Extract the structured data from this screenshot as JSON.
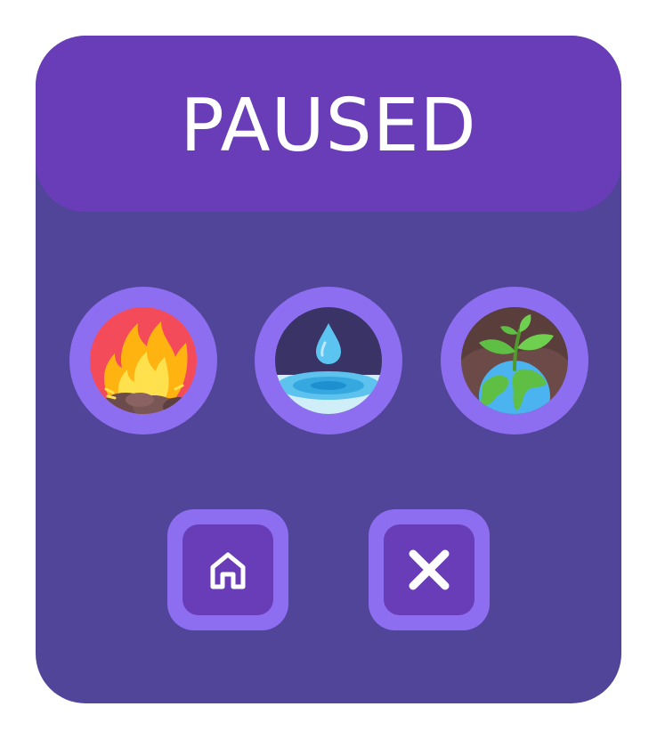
{
  "pause_menu": {
    "title": "PAUSED"
  },
  "elements": [
    {
      "name": "fire",
      "icon": "fire-icon"
    },
    {
      "name": "water",
      "icon": "water-drop-icon"
    },
    {
      "name": "earth",
      "icon": "earth-plant-icon"
    }
  ],
  "actions": {
    "home_icon": "home-icon",
    "close_icon": "close-icon"
  },
  "colors": {
    "panel": "#51459a",
    "header": "#683db7",
    "button_ring": "#8e6ef0",
    "button_inner": "#683db7",
    "title_text": "#ffffff"
  }
}
